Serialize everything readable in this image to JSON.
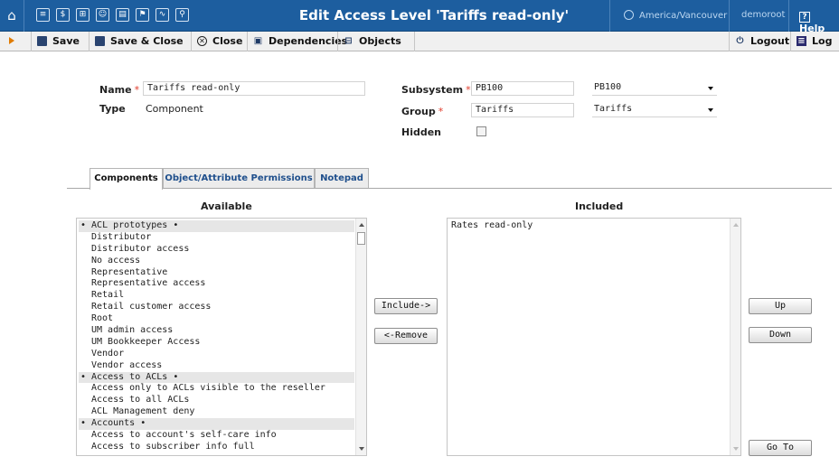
{
  "header": {
    "title": "Edit Access Level 'Tariffs read-only'",
    "timezone": "America/Vancouver",
    "user": "demoroot",
    "help_label": "Help",
    "icons": [
      "home-icon",
      "list-icon",
      "dollar-icon",
      "grid-icon",
      "person-icon",
      "accounts-icon",
      "tools-icon",
      "chart-icon",
      "search-icon"
    ]
  },
  "toolbar": {
    "save": "Save",
    "save_close": "Save & Close",
    "close": "Close",
    "dependencies": "Dependencies",
    "objects": "Objects",
    "logout": "Logout",
    "log": "Log"
  },
  "form": {
    "name_label": "Name",
    "name_value": "Tariffs read-only",
    "type_label": "Type",
    "type_value": "Component",
    "subsystem_label": "Subsystem",
    "subsystem_value": "PB100",
    "subsystem_select": "PB100",
    "group_label": "Group",
    "group_value": "Tariffs",
    "group_select": "Tariffs",
    "hidden_label": "Hidden",
    "hidden_checked": false
  },
  "tabs": [
    {
      "label": "Components",
      "active": true
    },
    {
      "label": "Object/Attribute Permissions",
      "active": false
    },
    {
      "label": "Notepad",
      "active": false
    }
  ],
  "available": {
    "header": "Available",
    "items": [
      {
        "label": "• ACL prototypes •",
        "group": true
      },
      {
        "label": "Distributor",
        "group": false
      },
      {
        "label": "Distributor access",
        "group": false
      },
      {
        "label": "No access",
        "group": false
      },
      {
        "label": "Representative",
        "group": false
      },
      {
        "label": "Representative access",
        "group": false
      },
      {
        "label": "Retail",
        "group": false
      },
      {
        "label": "Retail customer access",
        "group": false
      },
      {
        "label": "Root",
        "group": false
      },
      {
        "label": "UM admin access",
        "group": false
      },
      {
        "label": "UM Bookkeeper Access",
        "group": false
      },
      {
        "label": "Vendor",
        "group": false
      },
      {
        "label": "Vendor access",
        "group": false
      },
      {
        "label": "• Access to ACLs •",
        "group": true
      },
      {
        "label": "Access only to ACLs visible to the reseller",
        "group": false
      },
      {
        "label": "Access to all ACLs",
        "group": false
      },
      {
        "label": "ACL Management deny",
        "group": false
      },
      {
        "label": "• Accounts •",
        "group": true
      },
      {
        "label": "Access to account's self-care info",
        "group": false
      },
      {
        "label": "Access to subscriber info full",
        "group": false
      }
    ]
  },
  "included": {
    "header": "Included",
    "items": [
      "Rates read-only"
    ]
  },
  "buttons": {
    "include": "Include->",
    "remove": "<-Remove",
    "up": "Up",
    "down": "Down",
    "goto": "Go To"
  }
}
